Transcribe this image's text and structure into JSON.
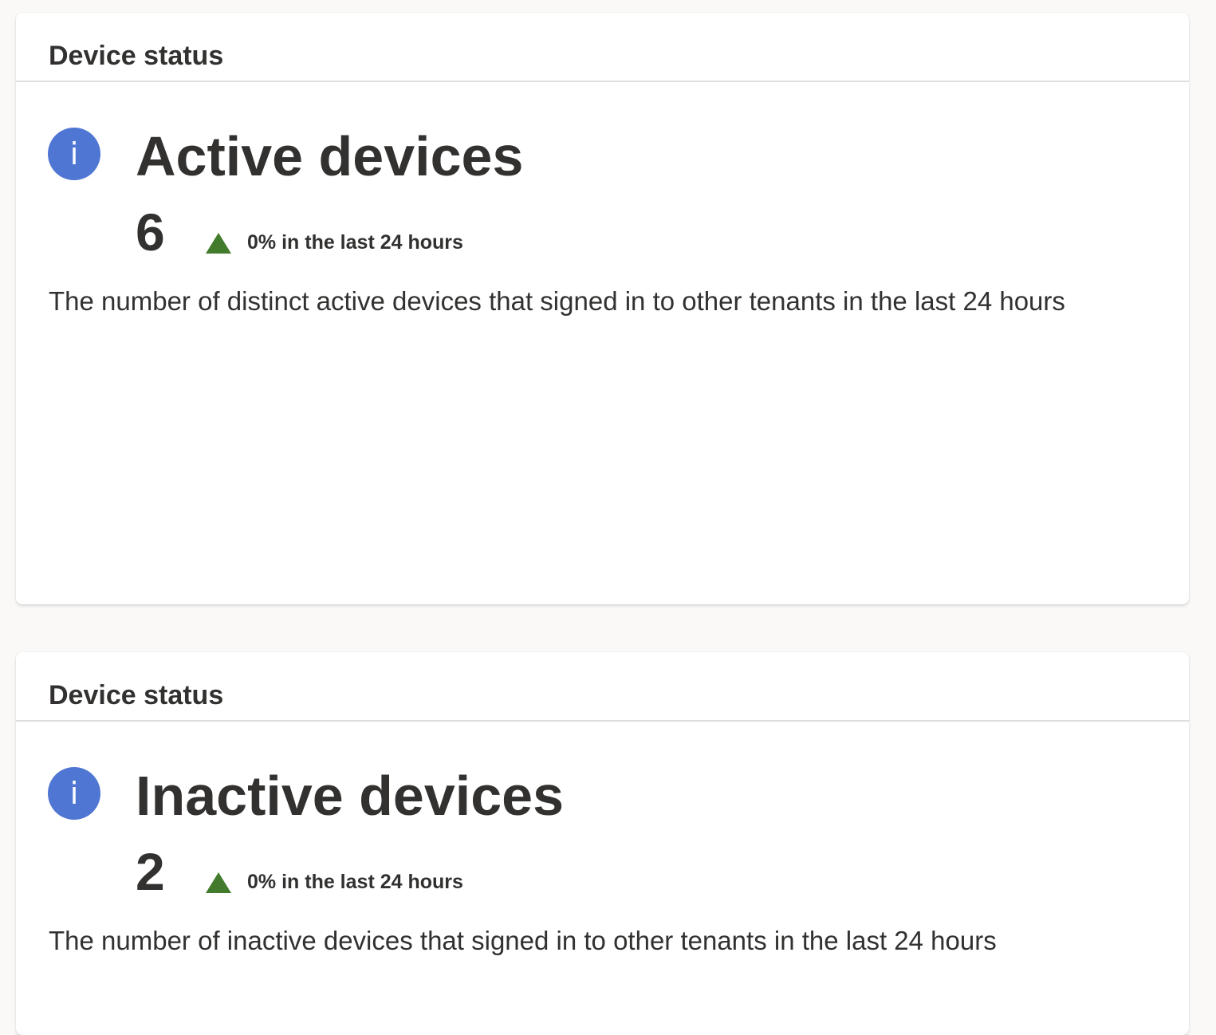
{
  "cards": [
    {
      "header": "Device status",
      "icon": "info-icon",
      "title": "Active devices",
      "value": "6",
      "trend_text": "0% in the last 24 hours",
      "trend_direction": "up",
      "description": "The number of distinct active devices that signed in to other tenants in the last 24 hours"
    },
    {
      "header": "Device status",
      "icon": "info-icon",
      "title": "Inactive devices",
      "value": "2",
      "trend_text": "0% in the last 24 hours",
      "trend_direction": "up",
      "description": "The number of inactive devices that signed in to other tenants in the last 24 hours"
    }
  ],
  "icon_glyph": "i",
  "colors": {
    "info_icon": "#4f76d3",
    "trend_up": "#427b2c",
    "text": "#323130",
    "divider": "#e1dfdd"
  }
}
